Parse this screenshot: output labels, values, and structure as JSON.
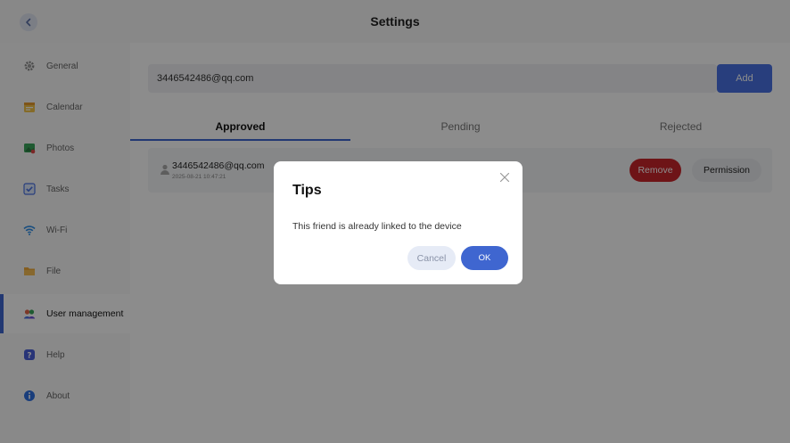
{
  "header": {
    "title": "Settings"
  },
  "sidebar": {
    "items": [
      {
        "label": "General",
        "icon": "gear-icon"
      },
      {
        "label": "Calendar",
        "icon": "calendar-icon"
      },
      {
        "label": "Photos",
        "icon": "photos-icon"
      },
      {
        "label": "Tasks",
        "icon": "checkbox-icon"
      },
      {
        "label": "Wi-Fi",
        "icon": "wifi-icon"
      },
      {
        "label": "File",
        "icon": "folder-icon"
      },
      {
        "label": "User management",
        "icon": "users-icon",
        "active": true
      },
      {
        "label": "Help",
        "icon": "help-icon"
      },
      {
        "label": "About",
        "icon": "info-icon"
      }
    ]
  },
  "main": {
    "email_value": "3446542486@qq.com",
    "add_label": "Add",
    "tabs": [
      {
        "label": "Approved",
        "active": true
      },
      {
        "label": "Pending"
      },
      {
        "label": "Rejected"
      }
    ],
    "friend": {
      "email": "3446542486@qq.com",
      "timestamp": "2025-08-21 10:47:21",
      "remove_label": "Remove",
      "permission_label": "Permission"
    }
  },
  "dialog": {
    "title": "Tips",
    "message": "This friend is already linked to the device",
    "cancel_label": "Cancel",
    "ok_label": "OK"
  },
  "colors": {
    "accent": "#3f66d0",
    "add_button": "#4a72e3",
    "remove_button": "#c9262b",
    "overlay": "rgba(0,0,0,0.45)"
  }
}
